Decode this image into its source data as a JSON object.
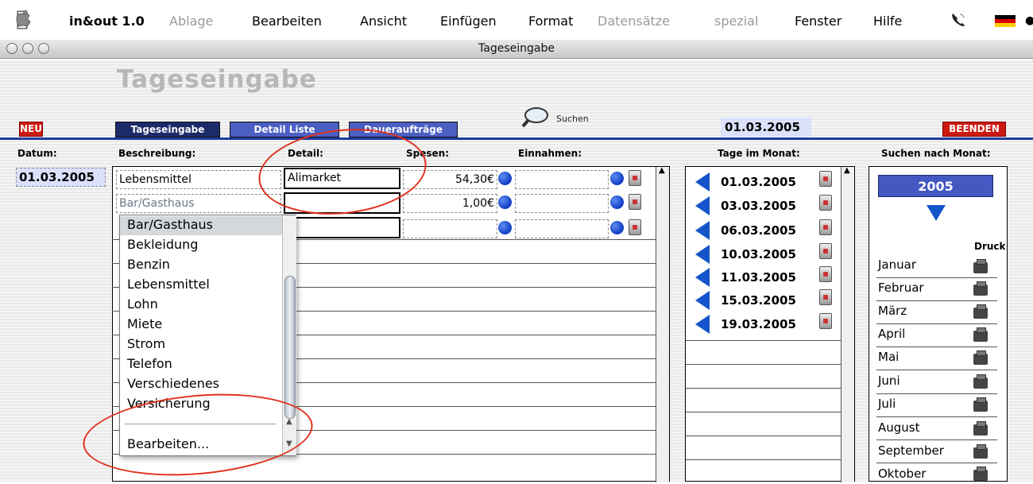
{
  "menubar": {
    "app_name": "in&out 1.0",
    "items": [
      {
        "label": "Ablage",
        "enabled": false
      },
      {
        "label": "Bearbeiten",
        "enabled": true
      },
      {
        "label": "Ansicht",
        "enabled": true
      },
      {
        "label": "Einfügen",
        "enabled": true
      },
      {
        "label": "Format",
        "enabled": true
      },
      {
        "label": "Datensätze",
        "enabled": false
      },
      {
        "label": "spezial",
        "enabled": false
      },
      {
        "label": "Fenster",
        "enabled": true
      },
      {
        "label": "Hilfe",
        "enabled": true
      }
    ]
  },
  "window": {
    "title": "Tageseingabe"
  },
  "page": {
    "heading": "Tageseingabe",
    "new_button": "NEU",
    "quit_button": "BEENDEN",
    "tabs": [
      {
        "label": "Tageseingabe",
        "active": true
      },
      {
        "label": "Detail Liste",
        "active": false
      },
      {
        "label": "Daueraufträge",
        "active": false
      }
    ],
    "search_label": "Suchen",
    "current_date": "01.03.2005"
  },
  "columns": {
    "datum": "Datum:",
    "beschreibung": "Beschreibung:",
    "detail": "Detail:",
    "spesen": "Spesen:",
    "einnahmen": "Einnahmen:",
    "tage": "Tage im Monat:",
    "suchen_monat": "Suchen nach Monat:"
  },
  "entry": {
    "date": "01.03.2005",
    "rows": [
      {
        "beschreibung": "Lebensmittel",
        "detail": "Alimarket",
        "spesen": "54,30€",
        "einnahmen": ""
      },
      {
        "beschreibung": "Bar/Gasthaus",
        "detail": "",
        "spesen": "1,00€",
        "einnahmen": ""
      },
      {
        "beschreibung": "",
        "detail": "",
        "spesen": "",
        "einnahmen": ""
      }
    ]
  },
  "dropdown": {
    "items": [
      "Bar/Gasthaus",
      "Bekleidung",
      "Benzin",
      "Lebensmittel",
      "Lohn",
      "Miete",
      "Strom",
      "Telefon",
      "Verschiedenes",
      "Versicherung"
    ],
    "selected": "Bar/Gasthaus",
    "edit_label": "Bearbeiten..."
  },
  "days": [
    "01.03.2005",
    "03.03.2005",
    "06.03.2005",
    "10.03.2005",
    "11.03.2005",
    "15.03.2005",
    "19.03.2005"
  ],
  "months_panel": {
    "year": "2005",
    "print_label": "Druck",
    "months": [
      "Januar",
      "Februar",
      "März",
      "April",
      "Mai",
      "Juni",
      "Juli",
      "August",
      "September",
      "Oktober"
    ]
  },
  "colors": {
    "accent_blue": "#1f3a9f",
    "tab_active": "#1d2a6a",
    "tab_inactive": "#4b5ec2",
    "red_button": "#cc1a10",
    "annotation_red": "#e0301c"
  },
  "icons": [
    "apple-icon",
    "phone-icon",
    "german-flag-icon",
    "search-magnifier-icon",
    "trash-icon",
    "printer-icon",
    "arrow-left-icon",
    "arrow-down-icon"
  ]
}
